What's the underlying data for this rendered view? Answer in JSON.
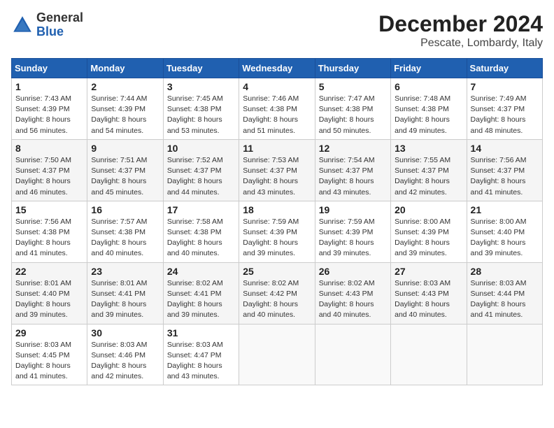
{
  "header": {
    "logo_general": "General",
    "logo_blue": "Blue",
    "month": "December 2024",
    "location": "Pescate, Lombardy, Italy"
  },
  "days_of_week": [
    "Sunday",
    "Monday",
    "Tuesday",
    "Wednesday",
    "Thursday",
    "Friday",
    "Saturday"
  ],
  "weeks": [
    [
      {
        "day": "1",
        "sunrise": "7:43 AM",
        "sunset": "4:39 PM",
        "daylight": "8 hours and 56 minutes."
      },
      {
        "day": "2",
        "sunrise": "7:44 AM",
        "sunset": "4:39 PM",
        "daylight": "8 hours and 54 minutes."
      },
      {
        "day": "3",
        "sunrise": "7:45 AM",
        "sunset": "4:38 PM",
        "daylight": "8 hours and 53 minutes."
      },
      {
        "day": "4",
        "sunrise": "7:46 AM",
        "sunset": "4:38 PM",
        "daylight": "8 hours and 51 minutes."
      },
      {
        "day": "5",
        "sunrise": "7:47 AM",
        "sunset": "4:38 PM",
        "daylight": "8 hours and 50 minutes."
      },
      {
        "day": "6",
        "sunrise": "7:48 AM",
        "sunset": "4:38 PM",
        "daylight": "8 hours and 49 minutes."
      },
      {
        "day": "7",
        "sunrise": "7:49 AM",
        "sunset": "4:37 PM",
        "daylight": "8 hours and 48 minutes."
      }
    ],
    [
      {
        "day": "8",
        "sunrise": "7:50 AM",
        "sunset": "4:37 PM",
        "daylight": "8 hours and 46 minutes."
      },
      {
        "day": "9",
        "sunrise": "7:51 AM",
        "sunset": "4:37 PM",
        "daylight": "8 hours and 45 minutes."
      },
      {
        "day": "10",
        "sunrise": "7:52 AM",
        "sunset": "4:37 PM",
        "daylight": "8 hours and 44 minutes."
      },
      {
        "day": "11",
        "sunrise": "7:53 AM",
        "sunset": "4:37 PM",
        "daylight": "8 hours and 43 minutes."
      },
      {
        "day": "12",
        "sunrise": "7:54 AM",
        "sunset": "4:37 PM",
        "daylight": "8 hours and 43 minutes."
      },
      {
        "day": "13",
        "sunrise": "7:55 AM",
        "sunset": "4:37 PM",
        "daylight": "8 hours and 42 minutes."
      },
      {
        "day": "14",
        "sunrise": "7:56 AM",
        "sunset": "4:37 PM",
        "daylight": "8 hours and 41 minutes."
      }
    ],
    [
      {
        "day": "15",
        "sunrise": "7:56 AM",
        "sunset": "4:38 PM",
        "daylight": "8 hours and 41 minutes."
      },
      {
        "day": "16",
        "sunrise": "7:57 AM",
        "sunset": "4:38 PM",
        "daylight": "8 hours and 40 minutes."
      },
      {
        "day": "17",
        "sunrise": "7:58 AM",
        "sunset": "4:38 PM",
        "daylight": "8 hours and 40 minutes."
      },
      {
        "day": "18",
        "sunrise": "7:59 AM",
        "sunset": "4:39 PM",
        "daylight": "8 hours and 39 minutes."
      },
      {
        "day": "19",
        "sunrise": "7:59 AM",
        "sunset": "4:39 PM",
        "daylight": "8 hours and 39 minutes."
      },
      {
        "day": "20",
        "sunrise": "8:00 AM",
        "sunset": "4:39 PM",
        "daylight": "8 hours and 39 minutes."
      },
      {
        "day": "21",
        "sunrise": "8:00 AM",
        "sunset": "4:40 PM",
        "daylight": "8 hours and 39 minutes."
      }
    ],
    [
      {
        "day": "22",
        "sunrise": "8:01 AM",
        "sunset": "4:40 PM",
        "daylight": "8 hours and 39 minutes."
      },
      {
        "day": "23",
        "sunrise": "8:01 AM",
        "sunset": "4:41 PM",
        "daylight": "8 hours and 39 minutes."
      },
      {
        "day": "24",
        "sunrise": "8:02 AM",
        "sunset": "4:41 PM",
        "daylight": "8 hours and 39 minutes."
      },
      {
        "day": "25",
        "sunrise": "8:02 AM",
        "sunset": "4:42 PM",
        "daylight": "8 hours and 40 minutes."
      },
      {
        "day": "26",
        "sunrise": "8:02 AM",
        "sunset": "4:43 PM",
        "daylight": "8 hours and 40 minutes."
      },
      {
        "day": "27",
        "sunrise": "8:03 AM",
        "sunset": "4:43 PM",
        "daylight": "8 hours and 40 minutes."
      },
      {
        "day": "28",
        "sunrise": "8:03 AM",
        "sunset": "4:44 PM",
        "daylight": "8 hours and 41 minutes."
      }
    ],
    [
      {
        "day": "29",
        "sunrise": "8:03 AM",
        "sunset": "4:45 PM",
        "daylight": "8 hours and 41 minutes."
      },
      {
        "day": "30",
        "sunrise": "8:03 AM",
        "sunset": "4:46 PM",
        "daylight": "8 hours and 42 minutes."
      },
      {
        "day": "31",
        "sunrise": "8:03 AM",
        "sunset": "4:47 PM",
        "daylight": "8 hours and 43 minutes."
      },
      null,
      null,
      null,
      null
    ]
  ]
}
